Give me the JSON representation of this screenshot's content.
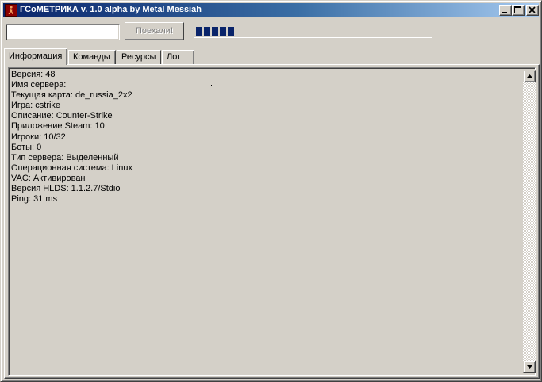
{
  "window": {
    "title": "ГСоМЕТРИКА v. 1.0 alpha by Metal Messiah",
    "controls": {
      "minimize": "_",
      "maximize": "□",
      "close": "×"
    }
  },
  "toolbar": {
    "address_value": "",
    "go_label": "Поехали!",
    "progress_segments": 5
  },
  "tabs": [
    {
      "label": "Информация",
      "active": true
    },
    {
      "label": "Команды",
      "active": false
    },
    {
      "label": "Ресурсы",
      "active": false
    },
    {
      "label": "Лог",
      "active": false
    }
  ],
  "info": {
    "lines": [
      "Версия: 48",
      "Имя сервера:",
      "Текущая карта: de_russia_2x2",
      "Игра: cstrike",
      "Описание: Counter-Strike",
      "Приложение Steam: 10",
      "Игроки: 10/32",
      "Боты: 0",
      "Тип сервера: Выделенный",
      "Операционная система: Linux",
      "VAC: Активирован",
      "Версия HLDS: 1.1.2.7/Stdio",
      "Ping: 31 ms"
    ]
  }
}
